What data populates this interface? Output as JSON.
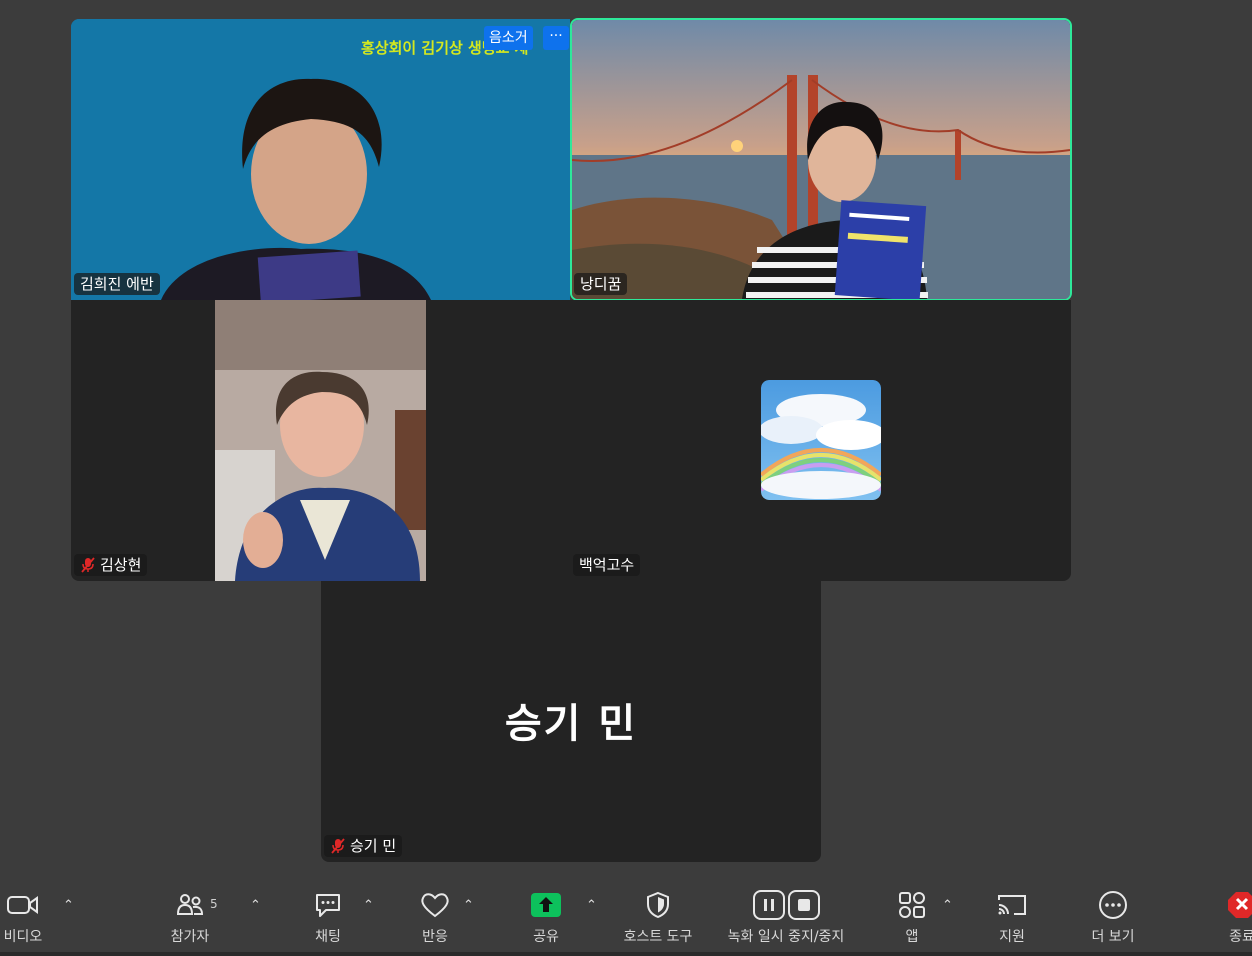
{
  "tiles": [
    {
      "name": "김희진 에반",
      "muted": false,
      "camera_on": true,
      "mirrored_text": "홍상회이 김기상 생명교 세"
    },
    {
      "name": "낭디꿈",
      "muted": false,
      "camera_on": true,
      "active_speaker": true
    },
    {
      "name": "김상현",
      "muted": true,
      "camera_on": true
    },
    {
      "name": "백억고수",
      "muted": false,
      "camera_on": false
    },
    {
      "name": "승기 민",
      "big_name": "승기 민",
      "muted": true,
      "camera_on": false
    }
  ],
  "tile_controls": {
    "mute_label": "음소거",
    "more_label": "···"
  },
  "toolbar": {
    "video": "비디오",
    "participants": "참가자",
    "participants_count": "5",
    "chat": "채팅",
    "reactions": "반응",
    "share": "공유",
    "host_tools": "호스트 도구",
    "recording": "녹화 일시 중지/중지",
    "apps": "앱",
    "support": "지원",
    "more": "더 보기",
    "end": "종료"
  },
  "colors": {
    "background": "#3c3c3c",
    "active_speaker_border": "#2ee89a",
    "share_green": "#0dc15c",
    "end_red": "#e02828",
    "mute_button_blue": "#0e72ed"
  },
  "icons": [
    "camera-icon",
    "participants-icon",
    "chat-icon",
    "heart-icon",
    "share-arrow-icon",
    "shield-icon",
    "pause-record-icon",
    "stop-record-icon",
    "apps-icon",
    "cast-icon",
    "more-dots-icon",
    "end-icon",
    "mic-muted-icon",
    "caret-up-icon"
  ]
}
